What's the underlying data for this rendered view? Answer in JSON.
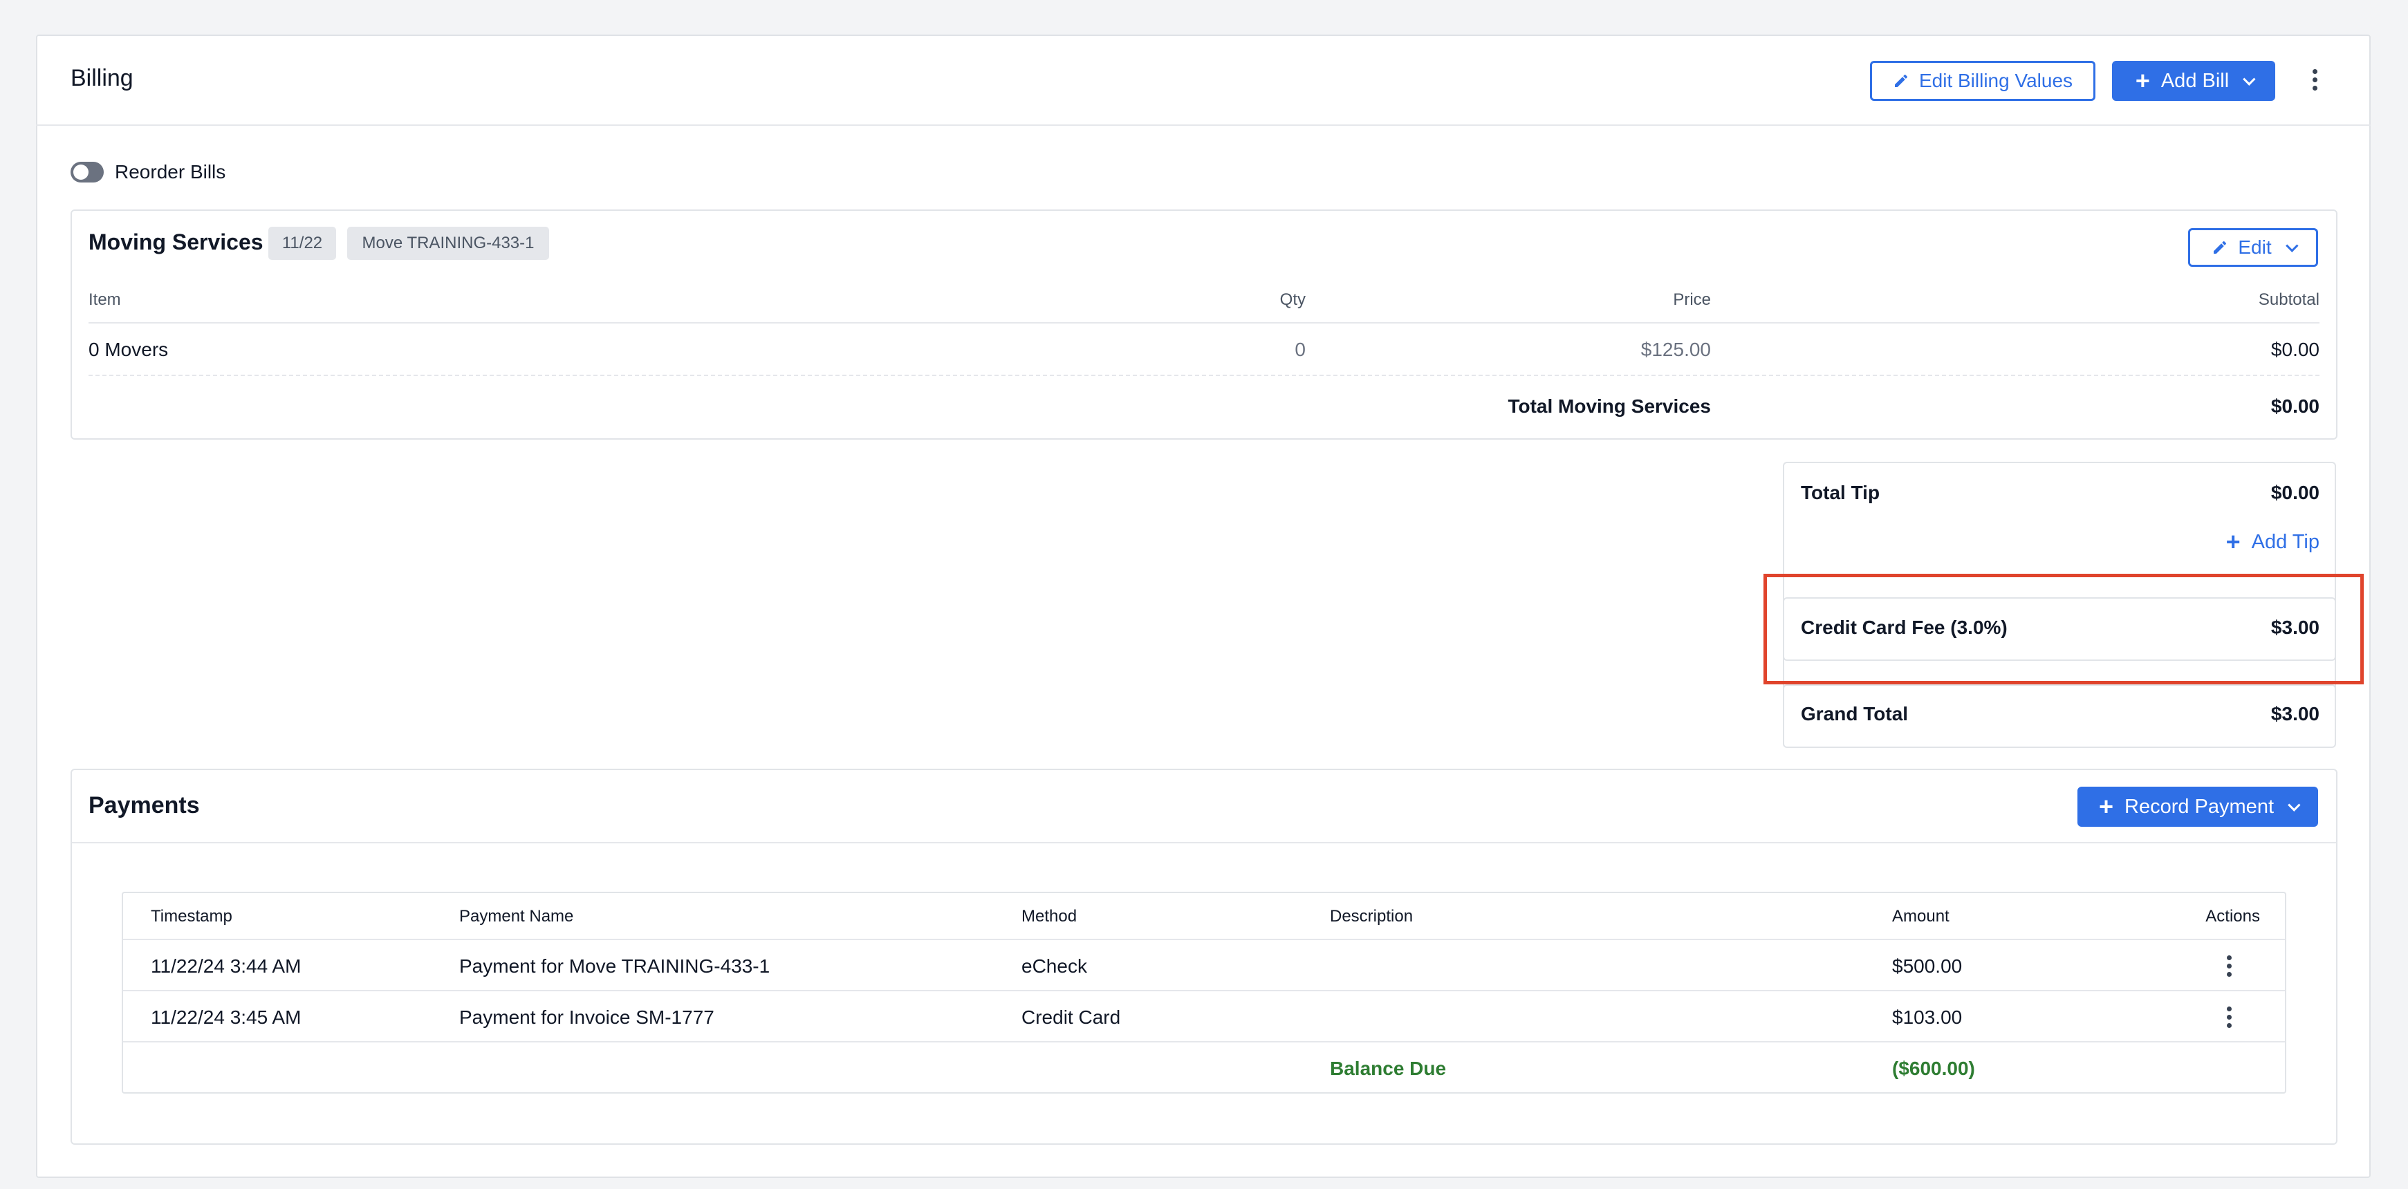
{
  "header": {
    "title": "Billing",
    "edit_billing_values_label": "Edit Billing Values",
    "add_bill_label": "Add Bill"
  },
  "reorder": {
    "label": "Reorder Bills",
    "enabled": false
  },
  "bill": {
    "title": "Moving Services",
    "date_tag": "11/22",
    "move_tag": "Move TRAINING-433-1",
    "edit_label": "Edit",
    "columns": {
      "item": "Item",
      "qty": "Qty",
      "price": "Price",
      "subtotal": "Subtotal"
    },
    "rows": [
      {
        "item": "0 Movers",
        "qty": "0",
        "price": "$125.00",
        "subtotal": "$0.00"
      }
    ],
    "total_label": "Total Moving Services",
    "total_value": "$0.00"
  },
  "summary": {
    "tip_label": "Total Tip",
    "tip_value": "$0.00",
    "add_tip_label": "Add Tip",
    "cc_fee_label": "Credit Card Fee (3.0%)",
    "cc_fee_value": "$3.00",
    "grand_total_label": "Grand Total",
    "grand_total_value": "$3.00"
  },
  "payments": {
    "title": "Payments",
    "record_payment_label": "Record Payment",
    "columns": {
      "timestamp": "Timestamp",
      "payment_name": "Payment Name",
      "method": "Method",
      "description": "Description",
      "amount": "Amount",
      "actions": "Actions"
    },
    "rows": [
      {
        "timestamp": "11/22/24 3:44 AM",
        "payment_name": "Payment for Move TRAINING-433-1",
        "method": "eCheck",
        "description": "",
        "amount": "$500.00"
      },
      {
        "timestamp": "11/22/24 3:45 AM",
        "payment_name": "Payment for Invoice SM-1777",
        "method": "Credit Card",
        "description": "",
        "amount": "$103.00"
      }
    ],
    "balance_label": "Balance Due",
    "balance_value": "($600.00)"
  },
  "colors": {
    "accent": "#2f6fe6",
    "highlight_box": "#e0442c",
    "balance_green": "#2e7d32"
  }
}
